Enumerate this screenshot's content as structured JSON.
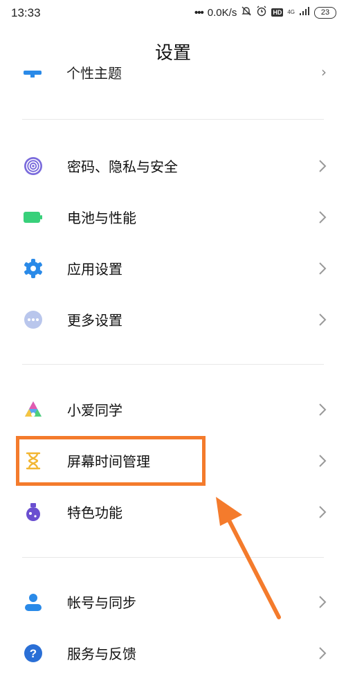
{
  "status": {
    "time": "13:33",
    "dots": "•••",
    "speed": "0.0K/s",
    "hd": "HD",
    "network": "4G",
    "battery": "23"
  },
  "header": {
    "title": "设置"
  },
  "partial_item": {
    "label": "个性主题"
  },
  "groups": [
    {
      "items": [
        {
          "label": "密码、隐私与安全",
          "icon": "fingerprint-icon"
        },
        {
          "label": "电池与性能",
          "icon": "battery-icon"
        },
        {
          "label": "应用设置",
          "icon": "gear-icon"
        },
        {
          "label": "更多设置",
          "icon": "more-dots-icon"
        }
      ]
    },
    {
      "items": [
        {
          "label": "小爱同学",
          "icon": "xiaoai-icon"
        },
        {
          "label": "屏幕时间管理",
          "icon": "hourglass-icon"
        },
        {
          "label": "特色功能",
          "icon": "flask-icon"
        }
      ]
    },
    {
      "items": [
        {
          "label": "帐号与同步",
          "icon": "user-icon"
        },
        {
          "label": "服务与反馈",
          "icon": "help-icon"
        }
      ]
    }
  ],
  "colors": {
    "highlight": "#f47b2c",
    "arrow": "#f47b2c",
    "accent_blue": "#2a8ae8",
    "battery_green": "#38d07a"
  }
}
